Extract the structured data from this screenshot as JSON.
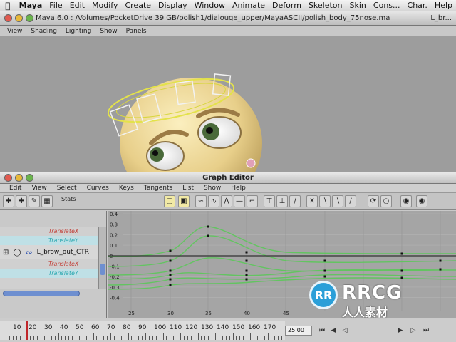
{
  "menubar": {
    "app": "Maya",
    "items": [
      "File",
      "Edit",
      "Modify",
      "Create",
      "Display",
      "Window",
      "Animate",
      "Deform",
      "Skeleton",
      "Skin",
      "Cons..."
    ],
    "right": [
      "Char.",
      "Help"
    ]
  },
  "titlebar": {
    "title": "Maya 6.0 : /Volumes/PocketDrive 39 GB/polish1/dialouge_upper/MayaASCII/polish_body_75nose.ma",
    "tail": "L_br..."
  },
  "panel_menu": [
    "View",
    "Shading",
    "Lighting",
    "Show",
    "Panels"
  ],
  "graph_editor": {
    "title": "Graph Editor",
    "menu": [
      "Edit",
      "View",
      "Select",
      "Curves",
      "Keys",
      "Tangents",
      "List",
      "Show",
      "Help"
    ],
    "stats_label": "Stats",
    "outliner": {
      "channel_top_1": "TranslateX",
      "channel_top_2": "TranslateY",
      "node_label": "L_brow_out_CTR",
      "channel_bottom_1": "TranslateX",
      "channel_bottom_2": "TranslateY"
    },
    "y_ticks": [
      "0.4",
      "0.3",
      "0.2",
      "0.1",
      "0",
      "-0.1",
      "-0.2",
      "-0.3",
      "-0.4"
    ],
    "x_ticks": [
      "25",
      "30",
      "35",
      "40",
      "45"
    ]
  },
  "timeline": {
    "ticks": [
      "10",
      "20",
      "30",
      "40",
      "50",
      "60",
      "70",
      "80",
      "90",
      "100",
      "110",
      "120",
      "130",
      "140",
      "150",
      "160",
      "170"
    ],
    "current_frame": "25.00"
  },
  "watermark": {
    "logo_letters": "RR",
    "brand": "RRCG",
    "subtitle": "人人素材"
  },
  "colors": {
    "curve_green": "#5cc85a",
    "curve_dark": "#2a2a2a",
    "channel_red": "#c2423a",
    "channel_cyan": "#2aa8b0"
  }
}
